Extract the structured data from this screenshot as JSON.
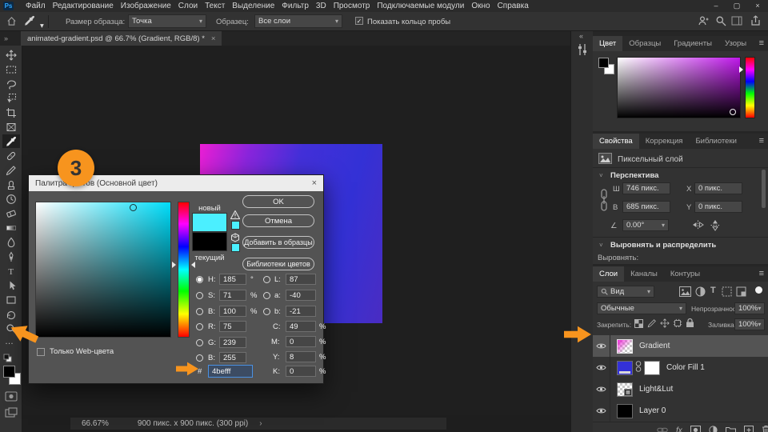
{
  "window": {
    "minimize": "–",
    "maximize": "▢",
    "close": "×",
    "logo": "Ps"
  },
  "menubar": {
    "items": [
      "Файл",
      "Редактирование",
      "Изображение",
      "Слои",
      "Текст",
      "Выделение",
      "Фильтр",
      "3D",
      "Просмотр",
      "Подключаемые модули",
      "Окно",
      "Справка"
    ]
  },
  "options_bar": {
    "sample_size_label": "Размер образца:",
    "sample_size_value": "Точка",
    "sample_label": "Образец:",
    "sample_value": "Все слои",
    "show_ring_label": "Показать кольцо пробы",
    "show_ring_checked": true
  },
  "document_tab": {
    "title": "animated-gradient.psd @ 66.7% (Gradient, RGB/8) *",
    "close": "×"
  },
  "toolbar": {
    "selected_tool": "eyedropper",
    "foreground_color": "#000000",
    "background_color": "#ffffff"
  },
  "canvas": {
    "gradient_start": "#ec1ed4",
    "gradient_end": "#3331d6"
  },
  "color_picker": {
    "title": "Палитра цветов (Основной цвет)",
    "close": "×",
    "new_label": "новый",
    "current_label": "текущий",
    "new_color": "#4befff",
    "current_color": "#000000",
    "buttons": {
      "ok": "OK",
      "cancel": "Отмена",
      "add_to_swatches": "Добавить в образцы",
      "color_libraries": "Библиотеки цветов"
    },
    "left_rows": [
      {
        "label": "H:",
        "value": "185",
        "unit": "°"
      },
      {
        "label": "S:",
        "value": "71",
        "unit": "%"
      },
      {
        "label": "B:",
        "value": "100",
        "unit": "%"
      },
      {
        "label": "R:",
        "value": "75",
        "unit": ""
      },
      {
        "label": "G:",
        "value": "239",
        "unit": ""
      },
      {
        "label": "B:",
        "value": "255",
        "unit": ""
      }
    ],
    "right_rows": [
      {
        "label": "L:",
        "value": "87",
        "unit": ""
      },
      {
        "label": "a:",
        "value": "-40",
        "unit": ""
      },
      {
        "label": "b:",
        "value": "-21",
        "unit": ""
      },
      {
        "label": "C:",
        "value": "49",
        "unit": "%"
      },
      {
        "label": "M:",
        "value": "0",
        "unit": "%"
      },
      {
        "label": "Y:",
        "value": "8",
        "unit": "%"
      },
      {
        "label": "K:",
        "value": "0",
        "unit": "%"
      }
    ],
    "hex_label": "#",
    "hex_value": "4befff",
    "web_only_label": "Только Web-цвета"
  },
  "annotations": {
    "badge": "3",
    "accent_color": "#f7941e"
  },
  "color_panel": {
    "tabs": [
      "Цвет",
      "Образцы",
      "Градиенты",
      "Узоры"
    ],
    "active_tab": "Цвет"
  },
  "properties_panel": {
    "tabs": [
      "Свойства",
      "Коррекция",
      "Библиотеки"
    ],
    "active_tab": "Свойства",
    "layer_type": "Пиксельный слой",
    "transform_section": "Перспектива",
    "w_label": "Ш",
    "w_value": "746 пикс.",
    "h_label": "В",
    "h_value": "685 пикс.",
    "x_label": "X",
    "x_value": "0 пикс.",
    "y_label": "Y",
    "y_value": "0 пикс.",
    "angle_value": "0.00°",
    "align_section": "Выровнять и распределить",
    "align_label": "Выровнять:"
  },
  "layers_panel": {
    "tabs": [
      "Слои",
      "Каналы",
      "Контуры"
    ],
    "active_tab": "Слои",
    "filter_value": "Вид",
    "blend_mode": "Обычные",
    "opacity_label": "Непрозрачность:",
    "opacity_value": "100%",
    "lock_label": "Закрепить:",
    "fill_label": "Заливка:",
    "fill_value": "100%",
    "layers": [
      {
        "name": "Gradient",
        "selected": true
      },
      {
        "name": "Color Fill 1",
        "selected": false
      },
      {
        "name": "Light&Lut",
        "selected": false
      },
      {
        "name": "Layer 0",
        "selected": false
      }
    ]
  },
  "status_bar": {
    "zoom": "66.67%",
    "doc_info": "900 пикс. x 900 пикс. (300 ppi)"
  },
  "icons": {
    "hamburger": "≡",
    "dropdown": "▾",
    "collapse_left": "«",
    "collapse_right": "»",
    "ellipsis": "…",
    "check": "✓",
    "chevron_right": "›",
    "section_chevron": "˅",
    "angle": "∠",
    "fx": "fx",
    "type": "T",
    "search": "Q"
  }
}
